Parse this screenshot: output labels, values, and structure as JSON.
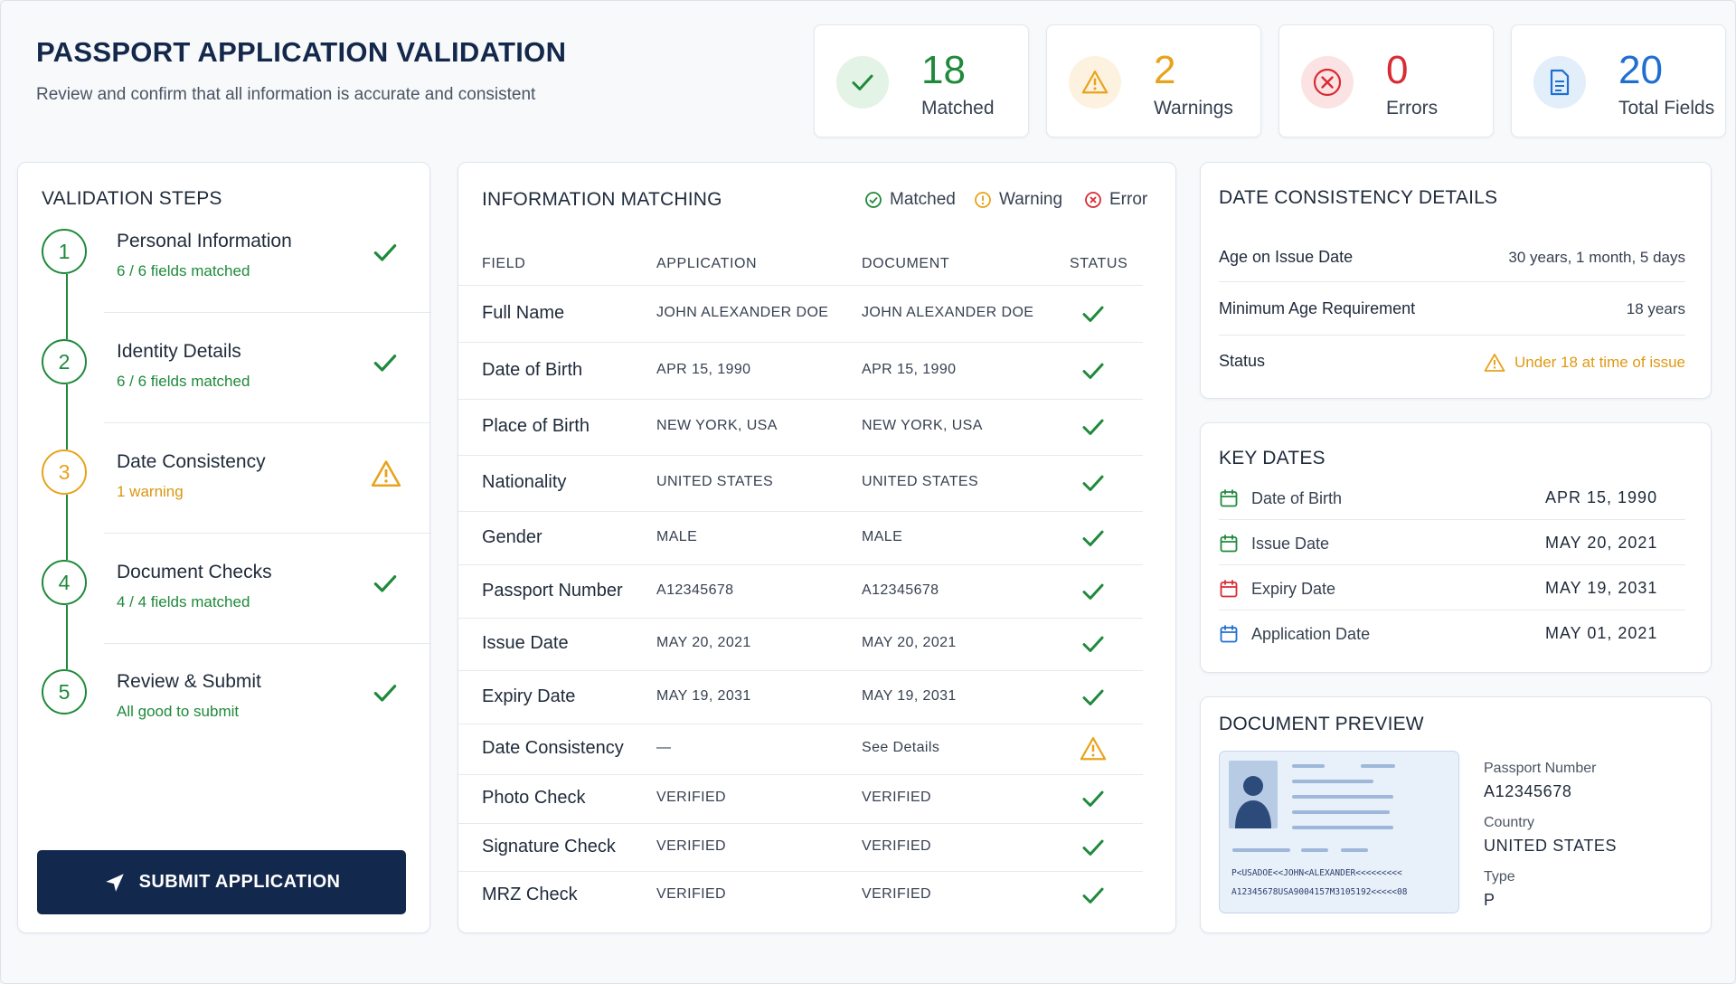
{
  "header": {
    "title": "PASSPORT APPLICATION VALIDATION",
    "subtitle": "Review and confirm that all information is accurate and consistent"
  },
  "stats": [
    {
      "value": "18",
      "label": "Matched",
      "icon": "check-icon",
      "color": "#1f8a3b",
      "bg": "#e3f3e6"
    },
    {
      "value": "2",
      "label": "Warnings",
      "icon": "warning-icon",
      "color": "#e8a31c",
      "bg": "#fdf2df"
    },
    {
      "value": "0",
      "label": "Errors",
      "icon": "error-icon",
      "color": "#d92b33",
      "bg": "#fbe3e4"
    },
    {
      "value": "20",
      "label": "Total Fields",
      "icon": "document-icon",
      "color": "#1f6fd1",
      "bg": "#e3eefb"
    }
  ],
  "steps": {
    "title": "VALIDATION STEPS",
    "items": [
      {
        "num": "1",
        "name": "Personal Information",
        "sub": "6 / 6 fields matched",
        "status": "ok"
      },
      {
        "num": "2",
        "name": "Identity Details",
        "sub": "6 / 6 fields matched",
        "status": "ok"
      },
      {
        "num": "3",
        "name": "Date Consistency",
        "sub": "1 warning",
        "status": "warn"
      },
      {
        "num": "4",
        "name": "Document Checks",
        "sub": "4 / 4 fields matched",
        "status": "ok"
      },
      {
        "num": "5",
        "name": "Review & Submit",
        "sub": "All good to submit",
        "status": "ok"
      }
    ],
    "submit_label": "SUBMIT APPLICATION"
  },
  "matching": {
    "title": "INFORMATION MATCHING",
    "legend": {
      "matched": "Matched",
      "warning": "Warning",
      "error": "Error"
    },
    "columns": [
      "FIELD",
      "APPLICATION",
      "DOCUMENT",
      "STATUS"
    ],
    "rows": [
      {
        "field": "Full Name",
        "application": "JOHN ALEXANDER DOE",
        "document": "JOHN ALEXANDER DOE",
        "status": "ok"
      },
      {
        "field": "Date of Birth",
        "application": "APR 15, 1990",
        "document": "APR 15, 1990",
        "status": "ok"
      },
      {
        "field": "Place of Birth",
        "application": "NEW YORK, USA",
        "document": "NEW YORK, USA",
        "status": "ok"
      },
      {
        "field": "Nationality",
        "application": "UNITED STATES",
        "document": "UNITED STATES",
        "status": "ok"
      },
      {
        "field": "Gender",
        "application": "MALE",
        "document": "MALE",
        "status": "ok"
      },
      {
        "field": "Passport Number",
        "application": "A12345678",
        "document": "A12345678",
        "status": "ok"
      },
      {
        "field": "Issue Date",
        "application": "MAY 20, 2021",
        "document": "MAY 20, 2021",
        "status": "ok"
      },
      {
        "field": "Expiry Date",
        "application": "MAY 19, 2031",
        "document": "MAY 19, 2031",
        "status": "ok"
      },
      {
        "field": "Date Consistency",
        "application": "—",
        "document": "See Details",
        "status": "warn"
      },
      {
        "field": "Photo Check",
        "application": "VERIFIED",
        "document": "VERIFIED",
        "status": "ok"
      },
      {
        "field": "Signature Check",
        "application": "VERIFIED",
        "document": "VERIFIED",
        "status": "ok"
      },
      {
        "field": "MRZ Check",
        "application": "VERIFIED",
        "document": "VERIFIED",
        "status": "ok"
      }
    ]
  },
  "date_consistency": {
    "title": "DATE CONSISTENCY DETAILS",
    "age_label": "Age on Issue Date",
    "age_value": "30 years, 1 month, 5 days",
    "min_age_label": "Minimum Age Requirement",
    "min_age_value": "18 years",
    "status_label": "Status",
    "status_value": "Under 18 at time of issue"
  },
  "key_dates": {
    "title": "KEY DATES",
    "items": [
      {
        "label": "Date of Birth",
        "value": "APR 15, 1990",
        "color": "#1f8a3b"
      },
      {
        "label": "Issue Date",
        "value": "MAY 20, 2021",
        "color": "#1f8a3b"
      },
      {
        "label": "Expiry Date",
        "value": "MAY 19, 2031",
        "color": "#d92b33"
      },
      {
        "label": "Application Date",
        "value": "MAY 01, 2021",
        "color": "#1f6fd1"
      }
    ]
  },
  "document_preview": {
    "title": "DOCUMENT PREVIEW",
    "mrz_line1": "P<USADOE<<JOHN<ALEXANDER<<<<<<<<<",
    "mrz_line2": "A12345678USA9004157M3105192<<<<<08",
    "passport_number_label": "Passport Number",
    "passport_number": "A12345678",
    "country_label": "Country",
    "country": "UNITED STATES",
    "type_label": "Type",
    "type": "P"
  }
}
